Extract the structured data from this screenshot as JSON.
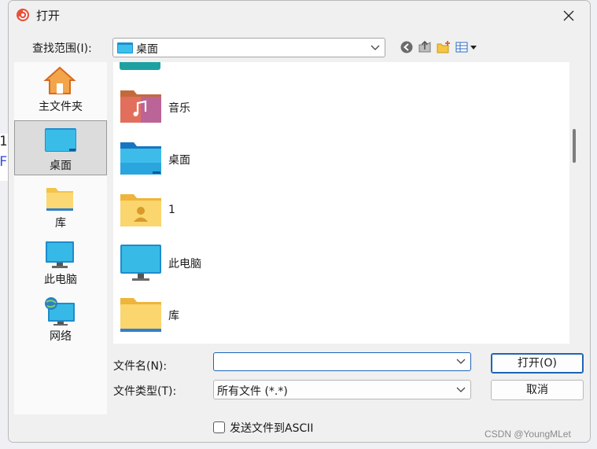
{
  "window": {
    "title": "打开",
    "close_icon": "close-icon"
  },
  "background_bleed": {
    "line1": "1",
    "line2": "F"
  },
  "lookin": {
    "label": "查找范围(I):",
    "value": "桌面"
  },
  "toolbar": [
    "back-icon",
    "up-folder-icon",
    "new-folder-icon",
    "view-menu-icon"
  ],
  "places": [
    {
      "label": "主文件夹",
      "icon": "home-icon"
    },
    {
      "label": "桌面",
      "icon": "desktop-icon",
      "selected": true
    },
    {
      "label": "库",
      "icon": "library-folder-icon"
    },
    {
      "label": "此电脑",
      "icon": "computer-icon"
    },
    {
      "label": "网络",
      "icon": "network-icon"
    }
  ],
  "files": [
    {
      "name": "音乐",
      "icon": "music-folder-icon"
    },
    {
      "name": "桌面",
      "icon": "desktop-folder-icon"
    },
    {
      "name": "1",
      "icon": "user-folder-icon"
    },
    {
      "name": "此电脑",
      "icon": "computer-icon"
    },
    {
      "name": "库",
      "icon": "library-folder-icon"
    }
  ],
  "filename": {
    "label": "文件名(N):",
    "value": ""
  },
  "filetype": {
    "label": "文件类型(T):",
    "value": "所有文件 (*.*)"
  },
  "buttons": {
    "open": "打开(O)",
    "cancel": "取消"
  },
  "checkbox": {
    "label": "发送文件到ASCII",
    "checked": false
  },
  "watermark": "CSDN @YoungMLet",
  "colors": {
    "accent": "#1f64b8",
    "folder_yellow": "#f7c544",
    "monitor_blue": "#1fa3d8"
  }
}
